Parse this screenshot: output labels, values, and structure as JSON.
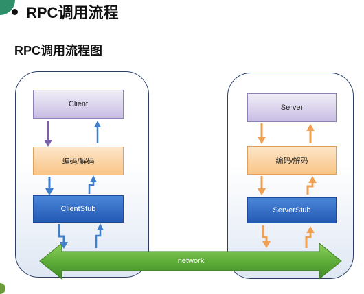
{
  "slide": {
    "heading": "RPC调用流程",
    "subheading": "RPC调用流程图"
  },
  "client_side": {
    "top_box": "Client",
    "middle_box": "编码/解码",
    "bottom_box": "ClientStub"
  },
  "server_side": {
    "top_box": "Server",
    "middle_box": "编码/解码",
    "bottom_box": "ServerStub"
  },
  "network": {
    "label": "network"
  },
  "colors": {
    "client_box": "#c9bde3",
    "codec_box": "#f9c486",
    "stub_box": "#2459b4",
    "network_arrow": "#66b33f",
    "client_down_arrow": "#7a5ea8",
    "client_arrow": "#3f7fcc",
    "server_arrow": "#f0a050",
    "panel_border": "#2b3f66"
  }
}
